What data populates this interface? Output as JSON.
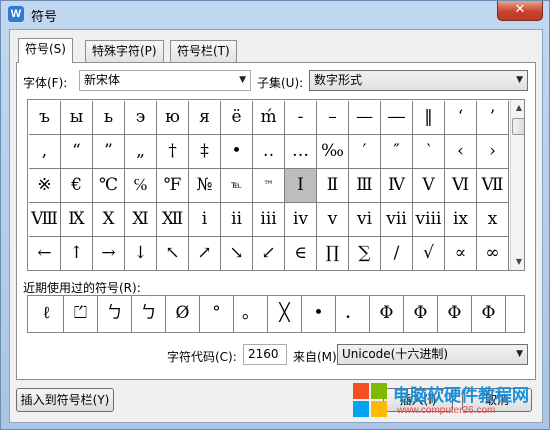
{
  "window": {
    "title": "符号",
    "icon": "W",
    "close": "✕"
  },
  "tabs": [
    {
      "label": "符号(S)",
      "active": true
    },
    {
      "label": "特殊字符(P)",
      "active": false
    },
    {
      "label": "符号栏(T)",
      "active": false
    }
  ],
  "font": {
    "label": "字体(F):",
    "value": "新宋体"
  },
  "subset": {
    "label": "子集(U):",
    "value": "数字形式"
  },
  "symbols": [
    "ъ",
    "ы",
    "ь",
    "э",
    "ю",
    "я",
    "ё",
    "ḿ",
    "-",
    "–",
    "—",
    "―",
    "‖",
    "‘",
    "’",
    ",",
    "“",
    "”",
    "„",
    "†",
    "‡",
    "•",
    "‥",
    "…",
    "‰",
    "′",
    "″",
    "‵",
    "‹",
    "›",
    "※",
    "€",
    "℃",
    "℅",
    "℉",
    "№",
    "℡",
    "™",
    "Ⅰ",
    "Ⅱ",
    "Ⅲ",
    "Ⅳ",
    "Ⅴ",
    "Ⅵ",
    "Ⅶ",
    "Ⅷ",
    "Ⅸ",
    "Ⅹ",
    "Ⅺ",
    "Ⅻ",
    "ⅰ",
    "ⅱ",
    "ⅲ",
    "ⅳ",
    "ⅴ",
    "ⅵ",
    "ⅶ",
    "ⅷ",
    "ⅸ",
    "ⅹ",
    "←",
    "↑",
    "→",
    "↓",
    "↖",
    "↗",
    "↘",
    "↙",
    "∈",
    "∏",
    "∑",
    "∕",
    "√",
    "∝",
    "∞"
  ],
  "selected_index": 38,
  "recent": {
    "label": "近期使用过的符号(R):",
    "items": [
      "ℓ",
      "⏍",
      "ㄅ",
      "ㄅ",
      "Ø",
      "°",
      "。",
      "╳",
      "•",
      "．",
      "Φ",
      "Φ",
      "Φ",
      "Φ"
    ]
  },
  "char_code": {
    "label": "字符代码(C):",
    "value": "2160"
  },
  "from": {
    "label": "来自(M)",
    "value": "Unicode(十六进制)"
  },
  "buttons": {
    "insert_to_bar": "插入到符号栏(Y)",
    "insert": "插入(I)",
    "cancel": "取消"
  },
  "watermark": {
    "title": "电脑软硬件教程网",
    "url": "www.computer26.com"
  },
  "colors": {
    "selected_cell": "#bdbdbd",
    "close_button": "#c7432b",
    "watermark_title": "#1a8fd8",
    "watermark_url": "#e04848"
  }
}
